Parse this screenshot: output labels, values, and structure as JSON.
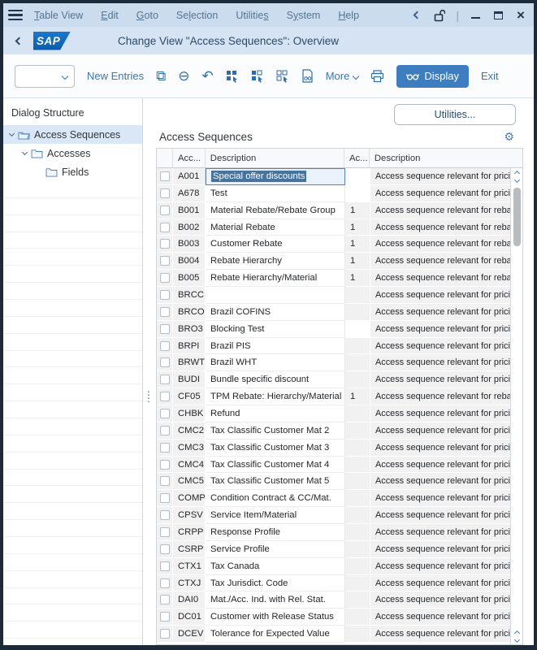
{
  "colors": {
    "frame": "#1d2a39",
    "menubar_bg": "#cbdcee",
    "titlebar_bg": "#d5e3f2",
    "accent_blue": "#3578b5",
    "display_button_bg": "#3d7dc0",
    "tree_selected_bg": "#d9e7f7",
    "readonly_cell_bg": "#f1f1f2",
    "selection_text_bg": "#46749f",
    "sap_logo_blue": "#0f68b8"
  },
  "menubar": {
    "items": [
      {
        "pre": "",
        "u": "T",
        "post": "able View"
      },
      {
        "pre": "",
        "u": "E",
        "post": "dit"
      },
      {
        "pre": "",
        "u": "G",
        "post": "oto"
      },
      {
        "pre": "Se",
        "u": "l",
        "post": "ection"
      },
      {
        "pre": "Utilitie",
        "u": "s",
        "post": ""
      },
      {
        "pre": "S",
        "u": "y",
        "post": "stem"
      },
      {
        "pre": "",
        "u": "H",
        "post": "elp"
      }
    ]
  },
  "titlebar": {
    "logo_text": "SAP",
    "title": "Change View \"Access Sequences\": Overview"
  },
  "toolbar": {
    "combo_value": "",
    "new_entries_label": "New Entries",
    "more_label": "More",
    "display_label": "Display",
    "exit_label": "Exit",
    "glyphs": {
      "copy": "⧉",
      "delete_row": "⊖",
      "undo": "↶"
    }
  },
  "sidebar": {
    "header": "Dialog Structure",
    "tree": [
      {
        "label": "Access Sequences"
      },
      {
        "label": "Accesses"
      },
      {
        "label": "Fields"
      }
    ],
    "empty_row_count": 27
  },
  "content": {
    "utilities_button_label": "Utilities...",
    "section_title": "Access Sequences",
    "gear_glyph": "⚙",
    "table": {
      "columns": [
        "Acc...",
        "Description",
        "Ac...",
        "Description"
      ],
      "rows": [
        {
          "code": "A001",
          "desc": "Special offer discounts",
          "ac": "",
          "usage": "Access sequence relevant for pricing",
          "selected": true,
          "ac_white": true
        },
        {
          "code": "A678",
          "desc": "Test",
          "ac": "",
          "usage": "Access sequence relevant for pricing",
          "ac_white": true
        },
        {
          "code": "B001",
          "desc": "Material Rebate/Rebate Group",
          "ac": "1",
          "usage": "Access sequence relevant for rebate"
        },
        {
          "code": "B002",
          "desc": "Material Rebate",
          "ac": "1",
          "usage": "Access sequence relevant for rebate"
        },
        {
          "code": "B003",
          "desc": "Customer Rebate",
          "ac": "1",
          "usage": "Access sequence relevant for rebate"
        },
        {
          "code": "B004",
          "desc": "Rebate Hierarchy",
          "ac": "1",
          "usage": "Access sequence relevant for rebate"
        },
        {
          "code": "B005",
          "desc": "Rebate Hierarchy/Material",
          "ac": "1",
          "usage": "Access sequence relevant for rebate"
        },
        {
          "code": "BRCC",
          "desc": "",
          "ac": "",
          "usage": "Access sequence relevant for pricing"
        },
        {
          "code": "BRCO",
          "desc": "Brazil COFINS",
          "ac": "",
          "usage": "Access sequence relevant for pricing"
        },
        {
          "code": "BRO3",
          "desc": "Blocking Test",
          "ac": "",
          "usage": "Access sequence relevant for pricing",
          "ac_white": true
        },
        {
          "code": "BRPI",
          "desc": "Brazil PIS",
          "ac": "",
          "usage": "Access sequence relevant for pricing"
        },
        {
          "code": "BRWT",
          "desc": "Brazil WHT",
          "ac": "",
          "usage": "Access sequence relevant for pricing"
        },
        {
          "code": "BUDI",
          "desc": "Bundle specific discount",
          "ac": "",
          "usage": "Access sequence relevant for pricing"
        },
        {
          "code": "CF05",
          "desc": "TPM Rebate: Hierarchy/Material",
          "ac": "1",
          "usage": "Access sequence relevant for rebate"
        },
        {
          "code": "CHBK",
          "desc": "Refund",
          "ac": "",
          "usage": "Access sequence relevant for pricing"
        },
        {
          "code": "CMC2",
          "desc": "Tax Classific Customer Mat 2",
          "ac": "",
          "usage": "Access sequence relevant for pricing"
        },
        {
          "code": "CMC3",
          "desc": "Tax Classific Customer Mat 3",
          "ac": "",
          "usage": "Access sequence relevant for pricing"
        },
        {
          "code": "CMC4",
          "desc": "Tax Classific Customer Mat 4",
          "ac": "",
          "usage": "Access sequence relevant for pricing"
        },
        {
          "code": "CMC5",
          "desc": "Tax Classific Customer Mat 5",
          "ac": "",
          "usage": "Access sequence relevant for pricing"
        },
        {
          "code": "COMP",
          "desc": "Condition Contract & CC/Mat.",
          "ac": "",
          "usage": "Access sequence relevant for pricing"
        },
        {
          "code": "CPSV",
          "desc": "Service Item/Material",
          "ac": "",
          "usage": "Access sequence relevant for pricing"
        },
        {
          "code": "CRPP",
          "desc": "Response Profile",
          "ac": "",
          "usage": "Access sequence relevant for pricing"
        },
        {
          "code": "CSRP",
          "desc": "Service Profile",
          "ac": "",
          "usage": "Access sequence relevant for pricing"
        },
        {
          "code": "CTX1",
          "desc": "Tax Canada",
          "ac": "",
          "usage": "Access sequence relevant for pricing"
        },
        {
          "code": "CTXJ",
          "desc": "Tax Jurisdict. Code",
          "ac": "",
          "usage": "Access sequence relevant for pricing"
        },
        {
          "code": "DAI0",
          "desc": "Mat./Acc. Ind. with Rel. Stat.",
          "ac": "",
          "usage": "Access sequence relevant for pricing"
        },
        {
          "code": "DC01",
          "desc": "Customer with Release Status",
          "ac": "",
          "usage": "Access sequence relevant for pricing"
        },
        {
          "code": "DCEV",
          "desc": "Tolerance for Expected Value",
          "ac": "",
          "usage": "Access sequence relevant for pricing"
        }
      ]
    }
  }
}
